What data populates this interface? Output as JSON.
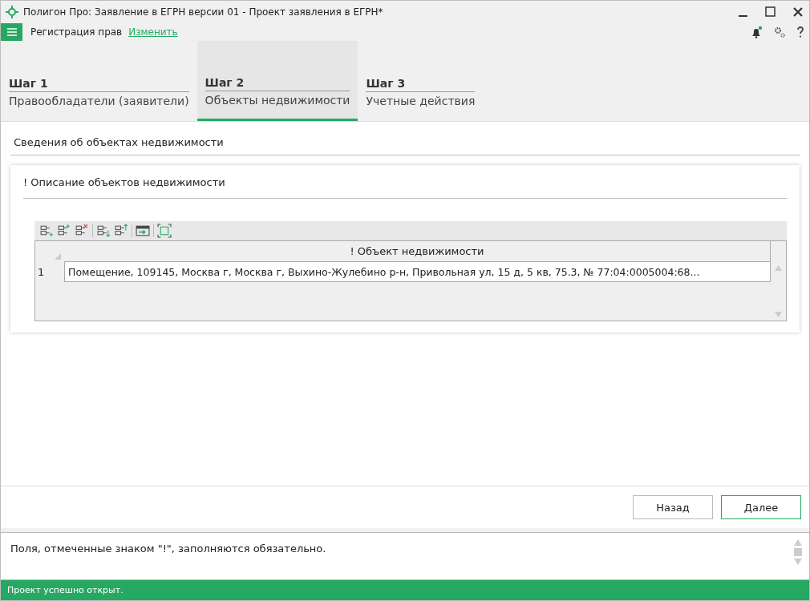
{
  "window": {
    "title": "Полигон Про: Заявление в ЕГРН версии 01 - Проект заявления в ЕГРН*"
  },
  "menu": {
    "section": "Регистрация прав",
    "change_link": "Изменить"
  },
  "steps": [
    {
      "step": "Шаг 1",
      "label": "Правообладатели (заявители)",
      "selected": false
    },
    {
      "step": "Шаг 2",
      "label": "Объекты недвижимости",
      "selected": true
    },
    {
      "step": "Шаг 3",
      "label": "Учетные действия",
      "selected": false
    }
  ],
  "section_title": "Сведения об объектах недвижимости",
  "card": {
    "title": "! Описание объектов недвижимости",
    "table": {
      "columns": [
        "! Объект недвижимости"
      ],
      "rows": [
        {
          "number": "1",
          "cells": [
            "Помещение, 109145, Москва г, Москва г, Выхино-Жулебино р-н, Привольная ул, 15 д, 5 кв, 75.3, № 77:04:0005004:68..."
          ]
        }
      ]
    }
  },
  "buttons": [
    {
      "label": "Назад",
      "kind": "default"
    },
    {
      "label": "Далее",
      "kind": "primary"
    }
  ],
  "hint": "Поля, отмеченные знаком \"!\", заполняются обязательно.",
  "status_bar": "Проект успешно открыт."
}
